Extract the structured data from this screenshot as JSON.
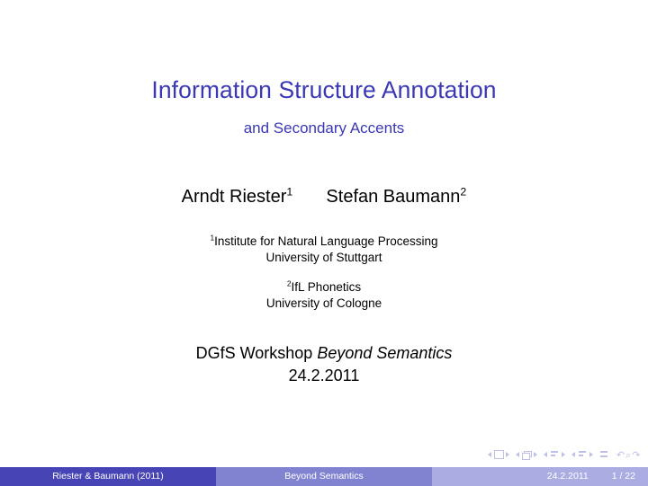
{
  "slide": {
    "title": "Information Structure Annotation",
    "subtitle": "and Secondary Accents",
    "title_color": "#3B38B4",
    "authors": [
      {
        "name": "Arndt Riester",
        "marker": "1"
      },
      {
        "name": "Stefan Baumann",
        "marker": "2"
      }
    ],
    "affiliations": [
      {
        "marker": "1",
        "institute": "Institute for Natural Language Processing",
        "university": "University of Stuttgart"
      },
      {
        "marker": "2",
        "institute": "IfL Phonetics",
        "university": "University of Cologne"
      }
    ],
    "event": {
      "prefix": "DGfS Workshop ",
      "workshop_title": "Beyond Semantics",
      "date": "24.2.2011"
    }
  },
  "navigation": {
    "items": [
      {
        "icon": "slide-icon",
        "label": "slide"
      },
      {
        "icon": "frame-icon",
        "label": "frame"
      },
      {
        "icon": "subsection-icon",
        "label": "subsection"
      },
      {
        "icon": "section-icon",
        "label": "section"
      },
      {
        "icon": "presentation-icon",
        "label": "presentation"
      }
    ],
    "arrows": {
      "back": "↶",
      "search": "⌕",
      "forward": "↷"
    }
  },
  "footer": {
    "author": "Riester & Baumann  (2011)",
    "title": "Beyond Semantics",
    "date": "24.2.2011",
    "page": "1 / 22",
    "colors": {
      "author_bg": "#4744B5",
      "title_bg": "#8183D0",
      "right_bg": "#ABACE2",
      "text": "#FFFFFF"
    }
  }
}
